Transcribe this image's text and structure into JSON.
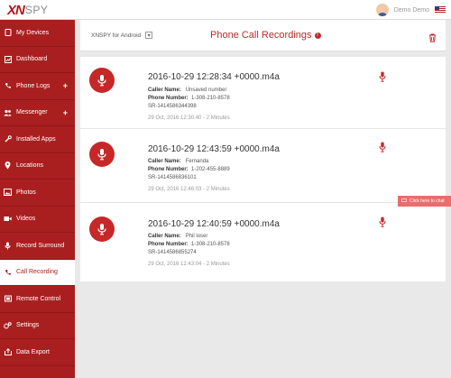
{
  "brand": {
    "logo_mark": "XN",
    "logo_text": "SPY"
  },
  "user": {
    "name": "Demo Demo",
    "flag": "us-flag-icon"
  },
  "sidebar": {
    "items": [
      {
        "label": "My Devices",
        "icon": "tablet-icon",
        "plus": ""
      },
      {
        "label": "Dashboard",
        "icon": "dashboard-icon",
        "plus": ""
      },
      {
        "label": "Phone Logs",
        "icon": "phone-icon",
        "plus": "+"
      },
      {
        "label": "Messenger",
        "icon": "users-icon",
        "plus": "+"
      },
      {
        "label": "Installed Apps",
        "icon": "wrench-icon",
        "plus": ""
      },
      {
        "label": "Locations",
        "icon": "map-marker-icon",
        "plus": ""
      },
      {
        "label": "Photos",
        "icon": "image-icon",
        "plus": ""
      },
      {
        "label": "Videos",
        "icon": "video-camera-icon",
        "plus": ""
      },
      {
        "label": "Record Surround",
        "icon": "microphone-icon",
        "plus": ""
      },
      {
        "label": "Call Recording",
        "icon": "call-icon",
        "plus": ""
      },
      {
        "label": "Remote Control",
        "icon": "remote-icon",
        "plus": ""
      },
      {
        "label": "Settings",
        "icon": "gears-icon",
        "plus": ""
      },
      {
        "label": "Data Export",
        "icon": "export-icon",
        "plus": ""
      }
    ]
  },
  "header": {
    "device": "XNSPY for Android",
    "caret": "▾",
    "title": "Phone Call Recordings",
    "info": "!"
  },
  "recordings": [
    {
      "file": "2016-10-29 12:28:34 +0000.m4a",
      "caller_label": "Caller Name:",
      "caller": "Unsaved number",
      "phone_label": "Phone Number:",
      "phone": "1-308-210-8578",
      "sr": "SR-1414586344398",
      "date": "29 Oct, 2016 12:30:40 - 2 Minutes"
    },
    {
      "file": "2016-10-29 12:43:59 +0000.m4a",
      "caller_label": "Caller Name:",
      "caller": "Fernanda",
      "phone_label": "Phone Number:",
      "phone": "1-202-455-8889",
      "sr": "SR-1414586836101",
      "date": "29 Oct, 2016 12:46:03 - 2 Minutes"
    },
    {
      "file": "2016-10-29 12:40:59 +0000.m4a",
      "caller_label": "Caller Name:",
      "caller": "Phil loser",
      "phone_label": "Phone Number:",
      "phone": "1-308-210-8578",
      "sr": "SR-1414586855274",
      "date": "29 Oct, 2016 12:43:04 - 2 Minutes"
    }
  ],
  "side_tab": {
    "label": "Click here to chat"
  },
  "colors": {
    "brand_red": "#a91f1f",
    "accent_red": "#c62828"
  }
}
